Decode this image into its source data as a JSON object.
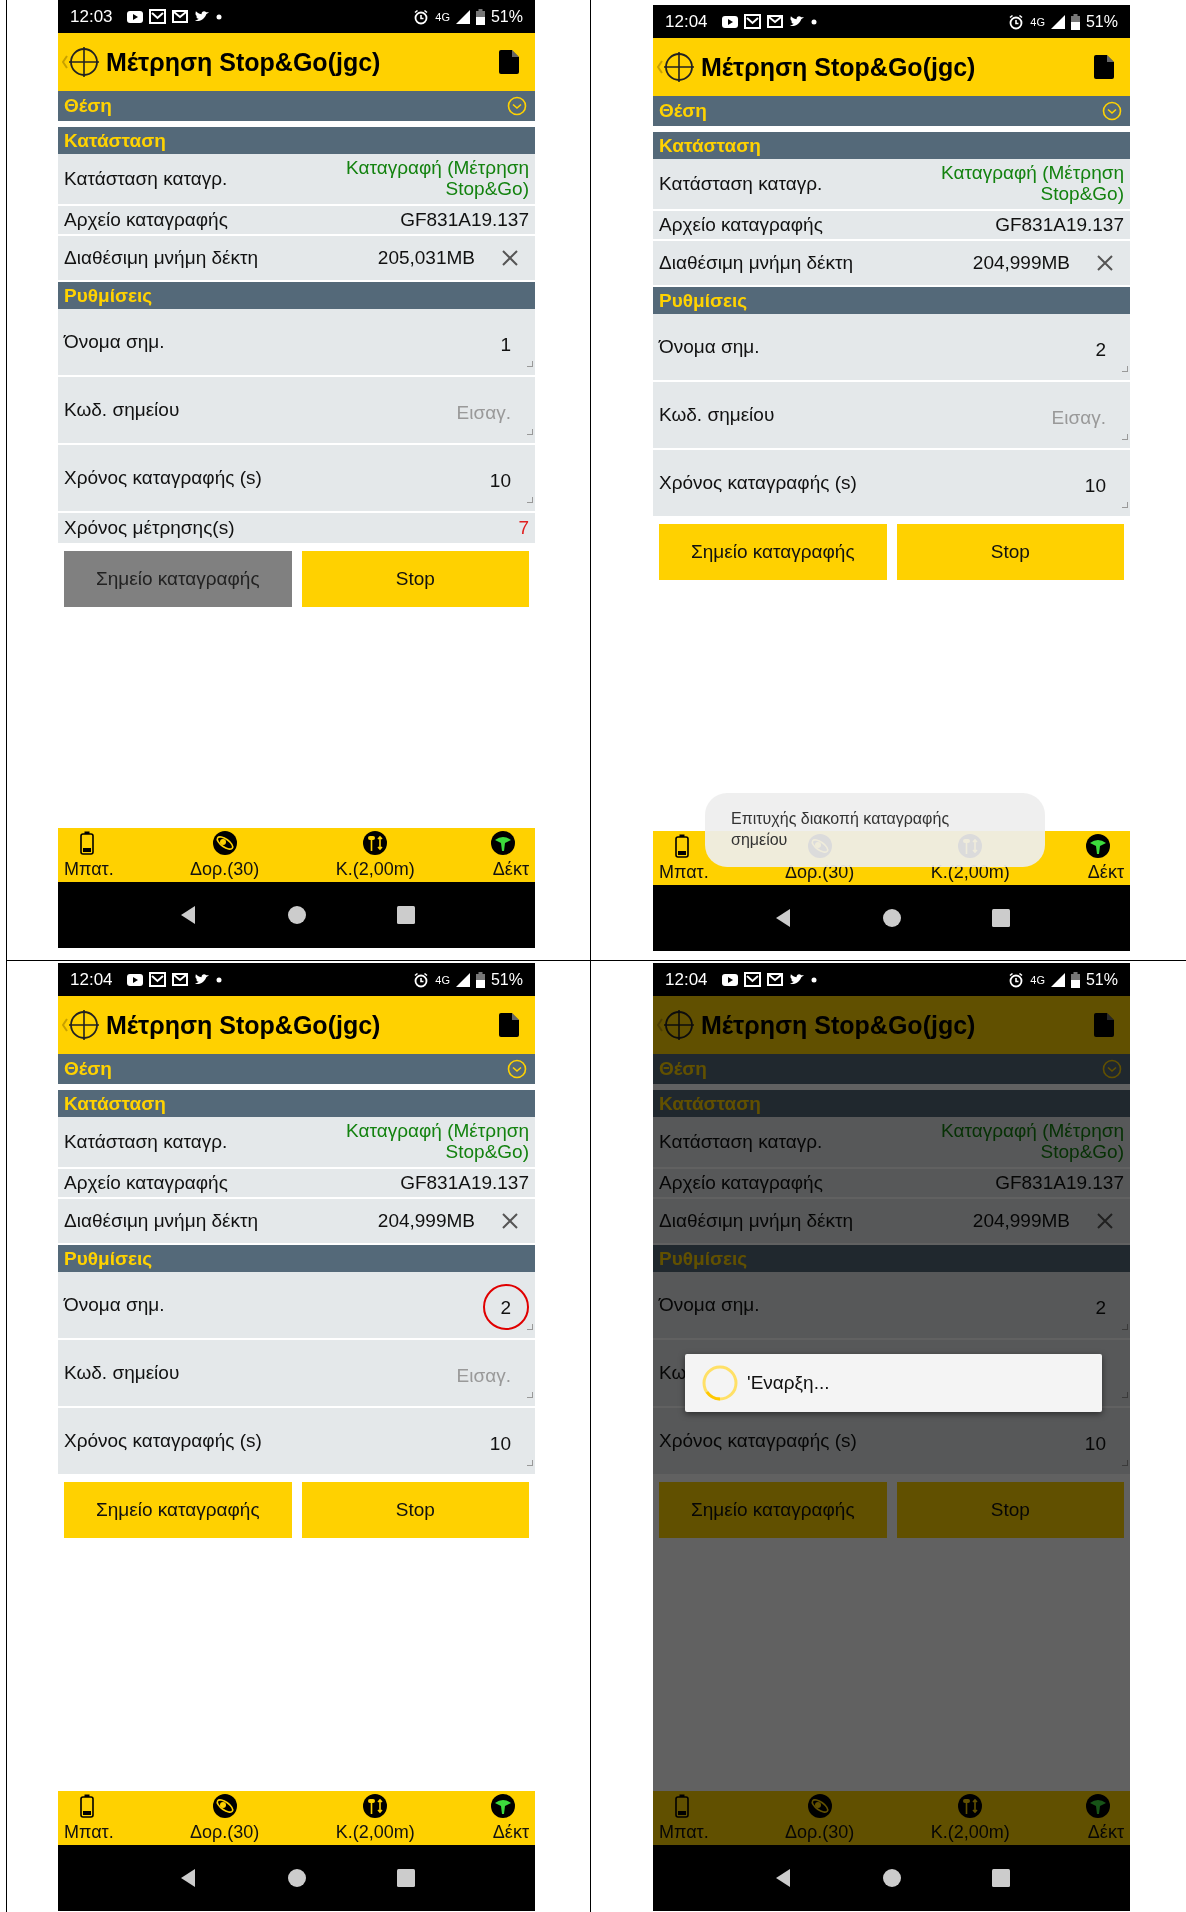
{
  "screens": [
    {
      "status_bar": {
        "time": "12:03",
        "network": "4G",
        "battery": "51%"
      },
      "app_bar": {
        "title": "Μέτρηση Stop&Go(jgc)"
      },
      "position_header": {
        "title": "Θέση"
      },
      "sections": [
        {
          "title": "Κατάσταση",
          "rows": [
            {
              "kind": "status",
              "label": "Κατάσταση καταγρ.",
              "value": "Καταγραφή (Μέτρηση Stop&Go)"
            },
            {
              "kind": "text",
              "label": "Αρχείο καταγραφής",
              "value": "GF831A19.137"
            },
            {
              "kind": "memory",
              "label": "Διαθέσιμη μνήμη δέκτη",
              "value": "205,031MB"
            }
          ]
        },
        {
          "title": "Ρυθμίσεις",
          "rows": [
            {
              "kind": "input",
              "label": "Όνομα σημ.",
              "value": "1",
              "circled": false
            },
            {
              "kind": "input",
              "label": "Κωδ. σημείου",
              "placeholder": "Εισαγ.",
              "circled": false
            },
            {
              "kind": "input",
              "label": "Χρόνος καταγραφής (s)",
              "value": "10",
              "circled": false
            },
            {
              "kind": "timer",
              "label": "Χρόνος μέτρησης(s)",
              "value": "7"
            }
          ]
        }
      ],
      "buttons": [
        {
          "label": "Σημείο καταγραφής",
          "disabled": true
        },
        {
          "label": "Stop",
          "disabled": false
        }
      ],
      "footer": [
        {
          "kind": "battery",
          "label": "Μπατ."
        },
        {
          "kind": "satellite",
          "label": "Δορ.(30)"
        },
        {
          "kind": "pole",
          "label": "Κ.(2,00m)"
        },
        {
          "kind": "receiver",
          "label": "Δέκτ"
        }
      ]
    },
    {
      "status_bar": {
        "time": "12:04",
        "network": "4G",
        "battery": "51%"
      },
      "app_bar": {
        "title": "Μέτρηση Stop&Go(jgc)"
      },
      "position_header": {
        "title": "Θέση"
      },
      "sections": [
        {
          "title": "Κατάσταση",
          "rows": [
            {
              "kind": "status",
              "label": "Κατάσταση καταγρ.",
              "value": "Καταγραφή (Μέτρηση Stop&Go)"
            },
            {
              "kind": "text",
              "label": "Αρχείο καταγραφής",
              "value": "GF831A19.137"
            },
            {
              "kind": "memory",
              "label": "Διαθέσιμη μνήμη δέκτη",
              "value": "204,999MB"
            }
          ]
        },
        {
          "title": "Ρυθμίσεις",
          "rows": [
            {
              "kind": "input",
              "label": "Όνομα σημ.",
              "value": "2",
              "circled": false
            },
            {
              "kind": "input",
              "label": "Κωδ. σημείου",
              "placeholder": "Εισαγ.",
              "circled": false
            },
            {
              "kind": "input",
              "label": "Χρόνος καταγραφής (s)",
              "value": "10",
              "circled": false
            }
          ]
        }
      ],
      "buttons": [
        {
          "label": "Σημείο καταγραφής",
          "disabled": false
        },
        {
          "label": "Stop",
          "disabled": false
        }
      ],
      "footer": [
        {
          "kind": "battery",
          "label": "Μπατ."
        },
        {
          "kind": "satellite",
          "label": "Δορ.(30)"
        },
        {
          "kind": "pole",
          "label": "Κ.(2,00m)"
        },
        {
          "kind": "receiver",
          "label": "Δέκτ"
        }
      ],
      "toast": {
        "text": "Επιτυχής διακοπή καταγραφής σημείου"
      }
    },
    {
      "status_bar": {
        "time": "12:04",
        "network": "4G",
        "battery": "51%"
      },
      "app_bar": {
        "title": "Μέτρηση Stop&Go(jgc)"
      },
      "position_header": {
        "title": "Θέση"
      },
      "sections": [
        {
          "title": "Κατάσταση",
          "rows": [
            {
              "kind": "status",
              "label": "Κατάσταση καταγρ.",
              "value": "Καταγραφή (Μέτρηση Stop&Go)"
            },
            {
              "kind": "text",
              "label": "Αρχείο καταγραφής",
              "value": "GF831A19.137"
            },
            {
              "kind": "memory",
              "label": "Διαθέσιμη μνήμη δέκτη",
              "value": "204,999MB"
            }
          ]
        },
        {
          "title": "Ρυθμίσεις",
          "rows": [
            {
              "kind": "input",
              "label": "Όνομα σημ.",
              "value": "2",
              "circled": true
            },
            {
              "kind": "input",
              "label": "Κωδ. σημείου",
              "placeholder": "Εισαγ.",
              "circled": false
            },
            {
              "kind": "input",
              "label": "Χρόνος καταγραφής (s)",
              "value": "10",
              "circled": false
            }
          ]
        }
      ],
      "buttons": [
        {
          "label": "Σημείο καταγραφής",
          "disabled": false
        },
        {
          "label": "Stop",
          "disabled": false
        }
      ],
      "footer": [
        {
          "kind": "battery",
          "label": "Μπατ."
        },
        {
          "kind": "satellite",
          "label": "Δορ.(30)"
        },
        {
          "kind": "pole",
          "label": "Κ.(2,00m)"
        },
        {
          "kind": "receiver",
          "label": "Δέκτ"
        }
      ]
    },
    {
      "status_bar": {
        "time": "12:04",
        "network": "4G",
        "battery": "51%"
      },
      "app_bar": {
        "title": "Μέτρηση Stop&Go(jgc)"
      },
      "position_header": {
        "title": "Θέση"
      },
      "sections": [
        {
          "title": "Κατάσταση",
          "rows": [
            {
              "kind": "status",
              "label": "Κατάσταση καταγρ.",
              "value": "Καταγραφή (Μέτρηση Stop&Go)"
            },
            {
              "kind": "text",
              "label": "Αρχείο καταγραφής",
              "value": "GF831A19.137"
            },
            {
              "kind": "memory",
              "label": "Διαθέσιμη μνήμη δέκτη",
              "value": "204,999MB"
            }
          ]
        },
        {
          "title": "Ρυθμίσεις",
          "rows": [
            {
              "kind": "input",
              "label": "Όνομα σημ.",
              "value": "2",
              "circled": false
            },
            {
              "kind": "input",
              "label": "Κω",
              "circled": false
            },
            {
              "kind": "input",
              "label": "Χρόνος καταγραφής (s)",
              "value": "10",
              "circled": false
            }
          ]
        }
      ],
      "buttons": [
        {
          "label": "Σημείο καταγραφής",
          "disabled": false
        },
        {
          "label": "Stop",
          "disabled": false
        }
      ],
      "footer": [
        {
          "kind": "battery",
          "label": "Μπατ."
        },
        {
          "kind": "satellite",
          "label": "Δορ.(30)"
        },
        {
          "kind": "pole",
          "label": "Κ.(2,00m)"
        },
        {
          "kind": "receiver",
          "label": "Δέκτ"
        }
      ],
      "dialog": {
        "text": "'Εναρξη..."
      }
    }
  ]
}
